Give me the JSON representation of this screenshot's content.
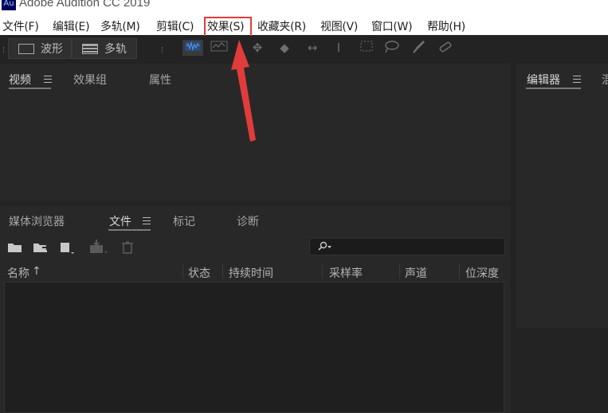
{
  "titlebar": {
    "logo_text": "Au",
    "title": "Adobe Audition CC 2019"
  },
  "menubar": {
    "items": [
      "文件(F)",
      "编辑(E)",
      "多轨(M)",
      "剪辑(C)",
      "效果(S)",
      "收藏夹(R)",
      "视图(V)",
      "窗口(W)",
      "帮助(H)"
    ],
    "highlighted_item": "效果(S)",
    "highlight_color": "#e23b3b"
  },
  "toolbar": {
    "view_buttons": [
      "波形",
      "多轨"
    ],
    "tools": [
      "spectral-frequency-icon",
      "spectral-pitch-icon",
      "move-tool-icon",
      "razor-tool-icon",
      "slip-tool-icon",
      "time-selection-icon",
      "marquee-selection-icon",
      "lasso-selection-icon",
      "brush-selection-icon",
      "spot-healing-icon"
    ]
  },
  "top_left_panel": {
    "tabs": [
      "视频",
      "效果组",
      "属性"
    ],
    "active_tab": "视频"
  },
  "right_panel": {
    "tabs": [
      "编辑器",
      "混"
    ],
    "active_tab": "编辑器"
  },
  "files_panel": {
    "tabs": [
      "媒体浏览器",
      "文件",
      "标记",
      "诊断"
    ],
    "active_tab": "文件",
    "search_placeholder": "",
    "columns": [
      "名称",
      "状态",
      "持续时间",
      "采样率",
      "声道",
      "位深度"
    ],
    "sort_indicator": "↑",
    "rows": []
  },
  "colors": {
    "panel_bg": "#282828",
    "app_bg": "#232323",
    "annotation_arrow": "#e23b3b"
  }
}
